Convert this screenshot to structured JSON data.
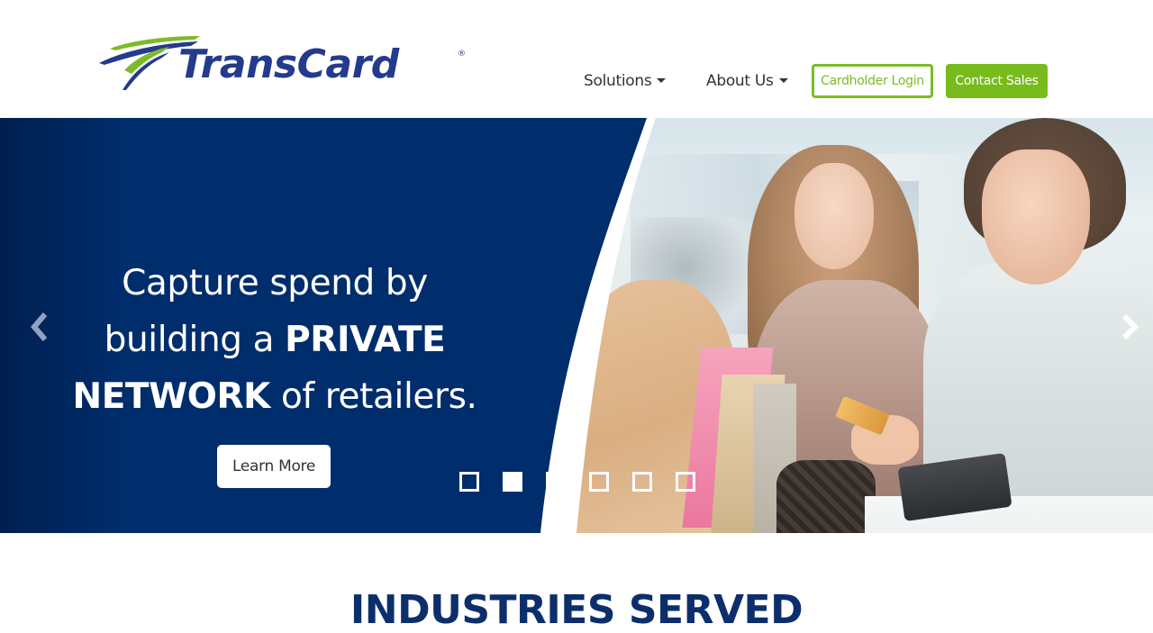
{
  "brand": {
    "name": "TransCard",
    "registered_mark": "®",
    "colors": {
      "navy": "#002d6b",
      "green": "#78bb1c",
      "logo_blue": "#243a8c",
      "logo_green": "#7cbb28"
    }
  },
  "nav": {
    "items": [
      {
        "label": "Solutions",
        "has_dropdown": true
      },
      {
        "label": "About Us",
        "has_dropdown": true
      }
    ],
    "login_button": "Cardholder Login",
    "contact_button": "Contact Sales"
  },
  "hero": {
    "headline": {
      "line1": "Capture spend by",
      "line2_regular": "building a ",
      "line2_bold": "PRIVATE",
      "line3_bold": "NETWORK",
      "line3_regular": " of retailers."
    },
    "cta_label": "Learn More",
    "prev_icon": "chevron-left-icon",
    "next_icon": "chevron-right-icon",
    "slides_total": 6,
    "active_slide": 2,
    "image_alt": "Shoppers paying with card at checkout"
  },
  "sections": {
    "industries_title": "INDUSTRIES SERVED"
  }
}
